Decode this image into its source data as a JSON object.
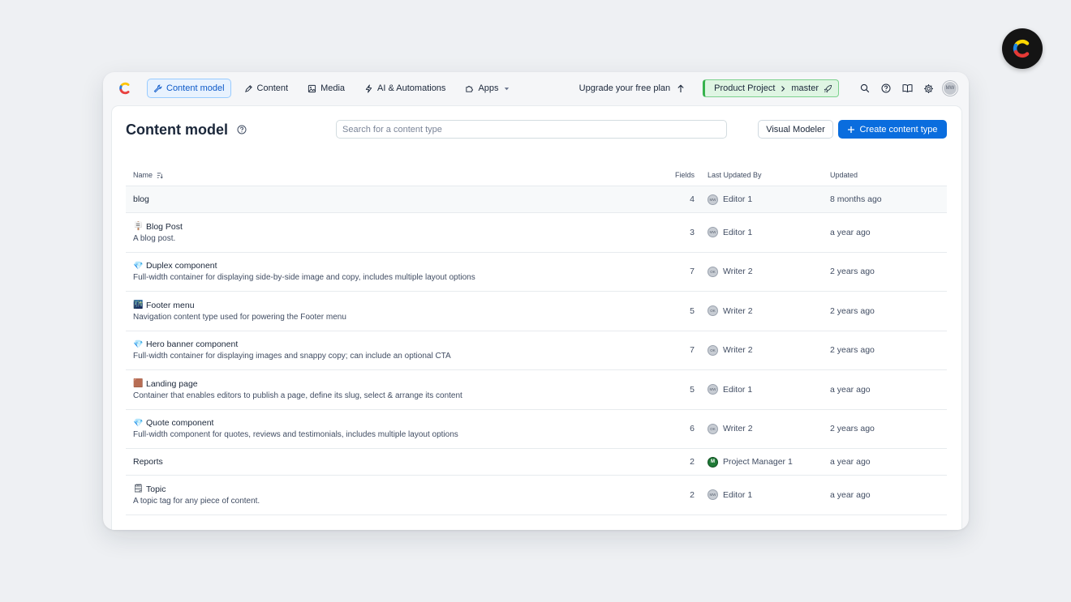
{
  "nav": {
    "items": [
      {
        "label": "Content model",
        "icon": "wrench-icon",
        "active": true
      },
      {
        "label": "Content",
        "icon": "pen-icon",
        "active": false
      },
      {
        "label": "Media",
        "icon": "image-icon",
        "active": false
      },
      {
        "label": "AI & Automations",
        "icon": "bolt-icon",
        "active": false
      },
      {
        "label": "Apps",
        "icon": "puzzle-icon",
        "active": false
      }
    ],
    "upgrade_label": "Upgrade your free plan",
    "project": "Product Project",
    "environment": "master",
    "user_initials": "MW"
  },
  "page": {
    "title": "Content model",
    "search_placeholder": "Search for a content type",
    "visual_modeler_label": "Visual Modeler",
    "create_label": "Create content type"
  },
  "table": {
    "headers": {
      "name": "Name",
      "fields": "Fields",
      "by": "Last Updated By",
      "updated": "Updated"
    },
    "rows": [
      {
        "emoji": "",
        "name": "blog",
        "desc": "",
        "fields": "4",
        "initials": "MW",
        "user": "Editor 1",
        "updated": "8 months ago"
      },
      {
        "emoji": "🪧",
        "name": "Blog Post",
        "desc": "A blog post.",
        "fields": "3",
        "initials": "MW",
        "user": "Editor 1",
        "updated": "a year ago"
      },
      {
        "emoji": "💎",
        "name": "Duplex component",
        "desc": "Full-width container for displaying side-by-side image and copy, includes multiple layout options",
        "fields": "7",
        "initials": "OK",
        "user": "Writer 2",
        "updated": "2 years ago"
      },
      {
        "emoji": "🌃",
        "name": "Footer menu",
        "desc": "Navigation content type used for powering the Footer menu",
        "fields": "5",
        "initials": "OK",
        "user": "Writer 2",
        "updated": "2 years ago"
      },
      {
        "emoji": "💎",
        "name": "Hero banner component",
        "desc": "Full-width container for displaying images and snappy copy; can include an optional CTA",
        "fields": "7",
        "initials": "OK",
        "user": "Writer 2",
        "updated": "2 years ago"
      },
      {
        "emoji": "🟫",
        "name": "Landing page",
        "desc": "Container that enables editors to publish a page, define its slug, select & arrange its content",
        "fields": "5",
        "initials": "MW",
        "user": "Editor 1",
        "updated": "a year ago"
      },
      {
        "emoji": "💎",
        "name": "Quote component",
        "desc": "Full-width component for quotes, reviews and testimonials, includes multiple layout options",
        "fields": "6",
        "initials": "OK",
        "user": "Writer 2",
        "updated": "2 years ago"
      },
      {
        "emoji": "",
        "name": "Reports",
        "desc": "",
        "fields": "2",
        "initials": "M",
        "user": "Project Manager 1",
        "updated": "a year ago"
      },
      {
        "emoji": "🗒",
        "name": "Topic",
        "desc": "A topic tag for any piece of content.",
        "fields": "2",
        "initials": "MW",
        "user": "Editor 1",
        "updated": "a year ago"
      }
    ]
  },
  "colors": {
    "primary": "#0a6dde",
    "active_nav_bg": "#e8f2fe",
    "env_green": "#37b24d",
    "logo_yellow": "#ffda00",
    "logo_red": "#eb5a68",
    "logo_blue": "#4a90e2"
  }
}
